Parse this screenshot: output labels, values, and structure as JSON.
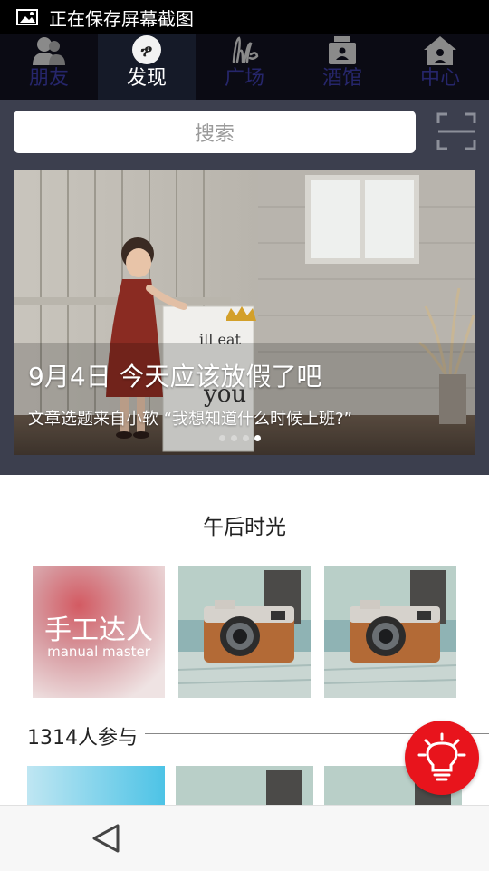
{
  "status_bar": {
    "text": "正在保存屏幕截图",
    "icon": "image-icon"
  },
  "nav": {
    "items": [
      {
        "label": "朋友",
        "icon": "friends-icon",
        "active": false
      },
      {
        "label": "发现",
        "icon": "discover-icon",
        "active": true
      },
      {
        "label": "广场",
        "icon": "life-icon",
        "active": false
      },
      {
        "label": "酒馆",
        "icon": "tavern-icon",
        "active": false
      },
      {
        "label": "中心",
        "icon": "home-icon",
        "active": false
      }
    ]
  },
  "search": {
    "placeholder": "搜索"
  },
  "banner": {
    "title": "9月4日  今天应该放假了吧",
    "subtitle": "文章选题来自小软 “我想知道什么时候上班?”",
    "sign_text_1": "ill eat",
    "sign_text_2": "you",
    "dot_count": 4,
    "active_dot": 3
  },
  "section": {
    "title": "午后时光",
    "thumbs": [
      {
        "title": "手工达人",
        "subtitle": "manual master"
      },
      {
        "image": "camera-photo"
      },
      {
        "image": "camera-photo"
      }
    ],
    "participants": "1314人参与"
  },
  "colors": {
    "accent": "#e8141c",
    "nav_bg": "#0b0b14",
    "nav_inactive": "#26266b",
    "banner_bg": "#3c3f4e"
  },
  "bottom": {
    "back_icon": "back-triangle-icon"
  }
}
